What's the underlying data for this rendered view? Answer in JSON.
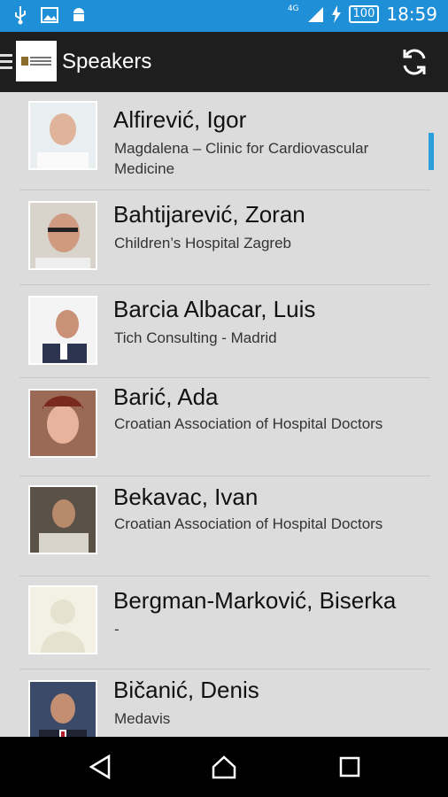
{
  "status_bar": {
    "time": "18:59",
    "battery": "100",
    "network": "4G",
    "icons": [
      "usb-icon",
      "image-icon",
      "android-icon",
      "signal-icon",
      "charging-icon",
      "battery-icon"
    ]
  },
  "app_bar": {
    "title": "Speakers",
    "icons": [
      "menu-icon",
      "refresh-icon"
    ]
  },
  "speakers": [
    {
      "name": "Alfirević, Igor",
      "org": "Magdalena – Clinic for Cardiovascular Medicine"
    },
    {
      "name": "Bahtijarević, Zoran",
      "org": "Children’s Hospital Zagreb"
    },
    {
      "name": "Barcia Albacar, Luis",
      "org": "Tich Consulting - Madrid"
    },
    {
      "name": "Barić, Ada",
      "org": "Croatian Association of Hospital Doctors"
    },
    {
      "name": "Bekavac, Ivan",
      "org": "Croatian Association of Hospital Doctors"
    },
    {
      "name": "Bergman-Marković, Biserka",
      "org": "-"
    },
    {
      "name": "Bičanić, Denis",
      "org": "Medavis"
    }
  ],
  "nav_bar": {
    "icons": [
      "back-icon",
      "home-icon",
      "recents-icon"
    ]
  },
  "colors": {
    "status_bar": "#1f8fd8",
    "app_bar": "#1e1e1e",
    "list_bg": "#dcdcdc",
    "scroll_accent": "#2b9fd9"
  }
}
